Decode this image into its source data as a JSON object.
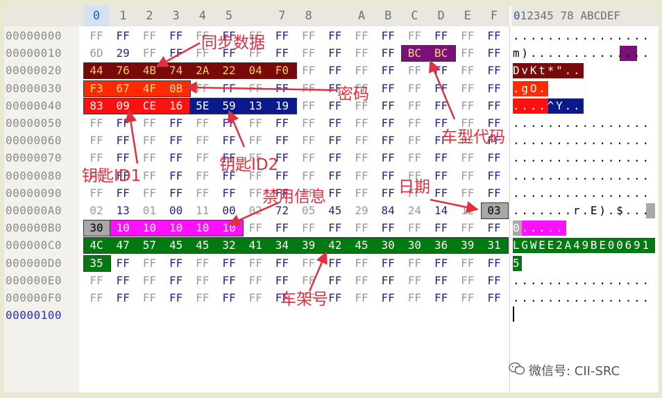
{
  "hex_editor": {
    "header_columns": [
      "0",
      "1",
      "2",
      "3",
      "4",
      "5",
      "",
      "7",
      "8",
      "",
      "A",
      "B",
      "C",
      "D",
      "E",
      "F"
    ],
    "ascii_header": "0123456789ABCDEF",
    "ascii_header_display_a": "012345 78 ABCDEF",
    "ascii_header_selected": "0",
    "offsets": [
      "00000000",
      "00000010",
      "00000020",
      "00000030",
      "00000040",
      "00000050",
      "00000060",
      "00000070",
      "00000080",
      "00000090",
      "000000A0",
      "000000B0",
      "000000C0",
      "000000D0",
      "000000E0",
      "000000F0",
      "00000100"
    ],
    "rows": [
      [
        "FF",
        "FF",
        "FF",
        "FF",
        "FF",
        "FF",
        "FF",
        "FF",
        "FF",
        "FF",
        "FF",
        "FF",
        "FF",
        "FF",
        "FF",
        "FF"
      ],
      [
        "6D",
        "29",
        "FF",
        "FF",
        "FF",
        "FF",
        "FF",
        "FF",
        "FF",
        "FF",
        "FF",
        "FF",
        "BC",
        "BC",
        "FF",
        "FF"
      ],
      [
        "44",
        "76",
        "4B",
        "74",
        "2A",
        "22",
        "04",
        "F0",
        "FF",
        "FF",
        "FF",
        "FF",
        "FF",
        "FF",
        "FF",
        "FF"
      ],
      [
        "F3",
        "67",
        "4F",
        "0B",
        "FF",
        "FF",
        "FF",
        "FF",
        "FF",
        "FF",
        "FF",
        "FF",
        "FF",
        "FF",
        "FF",
        "FF"
      ],
      [
        "83",
        "09",
        "CE",
        "16",
        "5E",
        "59",
        "13",
        "19",
        "FF",
        "FF",
        "FF",
        "FF",
        "FF",
        "FF",
        "FF",
        "FF"
      ],
      [
        "FF",
        "FF",
        "FF",
        "FF",
        "FF",
        "FF",
        "FF",
        "FF",
        "FF",
        "FF",
        "FF",
        "FF",
        "FF",
        "FF",
        "FF",
        "FF"
      ],
      [
        "FF",
        "FF",
        "FF",
        "FF",
        "FF",
        "FF",
        "FF",
        "FF",
        "FF",
        "FF",
        "FF",
        "FF",
        "FF",
        "FF",
        "FF",
        "FF"
      ],
      [
        "FF",
        "FF",
        "FF",
        "FF",
        "FF",
        "FF",
        "FF",
        "FF",
        "FF",
        "FF",
        "FF",
        "FF",
        "FF",
        "FF",
        "FF",
        "FF"
      ],
      [
        "FF",
        "FF",
        "FF",
        "FF",
        "FF",
        "FF",
        "FF",
        "FF",
        "FF",
        "FF",
        "FF",
        "FF",
        "FF",
        "FF",
        "FF",
        "FF"
      ],
      [
        "FF",
        "FF",
        "FF",
        "FF",
        "FF",
        "FF",
        "FF",
        "FF",
        "FF",
        "FF",
        "FF",
        "FF",
        "FF",
        "FF",
        "FF",
        "FF"
      ],
      [
        "02",
        "13",
        "01",
        "00",
        "11",
        "00",
        "02",
        "72",
        "05",
        "45",
        "29",
        "84",
        "24",
        "14",
        "12",
        "03"
      ],
      [
        "30",
        "10",
        "10",
        "10",
        "10",
        "10",
        "FF",
        "FF",
        "FF",
        "FF",
        "FF",
        "FF",
        "FF",
        "FF",
        "FF",
        "FF"
      ],
      [
        "4C",
        "47",
        "57",
        "45",
        "45",
        "32",
        "41",
        "34",
        "39",
        "42",
        "45",
        "30",
        "30",
        "36",
        "39",
        "31"
      ],
      [
        "35",
        "FF",
        "FF",
        "FF",
        "FF",
        "FF",
        "FF",
        "FF",
        "FF",
        "FF",
        "FF",
        "FF",
        "FF",
        "FF",
        "FF",
        "FF"
      ],
      [
        "FF",
        "FF",
        "FF",
        "FF",
        "FF",
        "FF",
        "FF",
        "FF",
        "FF",
        "FF",
        "FF",
        "FF",
        "FF",
        "FF",
        "FF",
        "FF"
      ],
      [
        "FF",
        "FF",
        "FF",
        "FF",
        "FF",
        "FF",
        "FF",
        "FF",
        "FF",
        "FF",
        "FF",
        "FF",
        "FF",
        "FF",
        "FF",
        "FF"
      ]
    ],
    "ascii_rows": [
      "................",
      "m)..............",
      "DvKt*\"..........",
      ".gO.............",
      "....^Y..........",
      "................",
      "................",
      "................",
      "................",
      "................",
      ".......r.E).$...",
      "0...............",
      "LGWEE2A49BE00691",
      "5...............",
      "................",
      "................"
    ],
    "highlights": [
      {
        "label": "sync",
        "row": 2,
        "start": 0,
        "len": 8,
        "bg": "#7a0a0a",
        "fg": "#f5d060"
      },
      {
        "label": "password",
        "row": 3,
        "start": 0,
        "len": 4,
        "bg": "#ff2a00",
        "fg": "#ffe090"
      },
      {
        "label": "key_id1",
        "row": 4,
        "start": 0,
        "len": 4,
        "bg": "#ff1010",
        "fg": "#ffffff"
      },
      {
        "label": "key_id2",
        "row": 4,
        "start": 4,
        "len": 4,
        "bg": "#0a1a8a",
        "fg": "#ffffff"
      },
      {
        "label": "model_code",
        "row": 1,
        "start": 12,
        "len": 2,
        "bg": "#7a1078",
        "fg": "#ffd870"
      },
      {
        "label": "date",
        "row": 10,
        "start": 15,
        "len": 1,
        "bg": "#a8a8a8",
        "fg": "#000000"
      },
      {
        "label": "date2",
        "row": 11,
        "start": 0,
        "len": 1,
        "bg": "#a8a8a8",
        "fg": "#000000"
      },
      {
        "label": "disable_info",
        "row": 11,
        "start": 1,
        "len": 5,
        "bg": "#ff10ff",
        "fg": "#ffffff"
      },
      {
        "label": "vin",
        "row": 12,
        "start": 0,
        "len": 16,
        "bg": "#007a10",
        "fg": "#ffffff"
      },
      {
        "label": "vin2",
        "row": 13,
        "start": 0,
        "len": 1,
        "bg": "#007a10",
        "fg": "#ffffff"
      }
    ],
    "colors": {
      "gray_text": "#9a9a9a",
      "blue_text": "#252580",
      "annotation_red": "#e03040"
    }
  },
  "annotations": {
    "sync_data": "同步数据",
    "password": "密码",
    "model_code": "车型代码",
    "key_id1": "钥匙ID1",
    "key_id2": "钥匙ID2",
    "disable_info": "禁用信息",
    "date": "日期",
    "vin": "车架号"
  },
  "watermark": {
    "icon": "wechat-icon",
    "text": "微信号: CII-SRC"
  }
}
